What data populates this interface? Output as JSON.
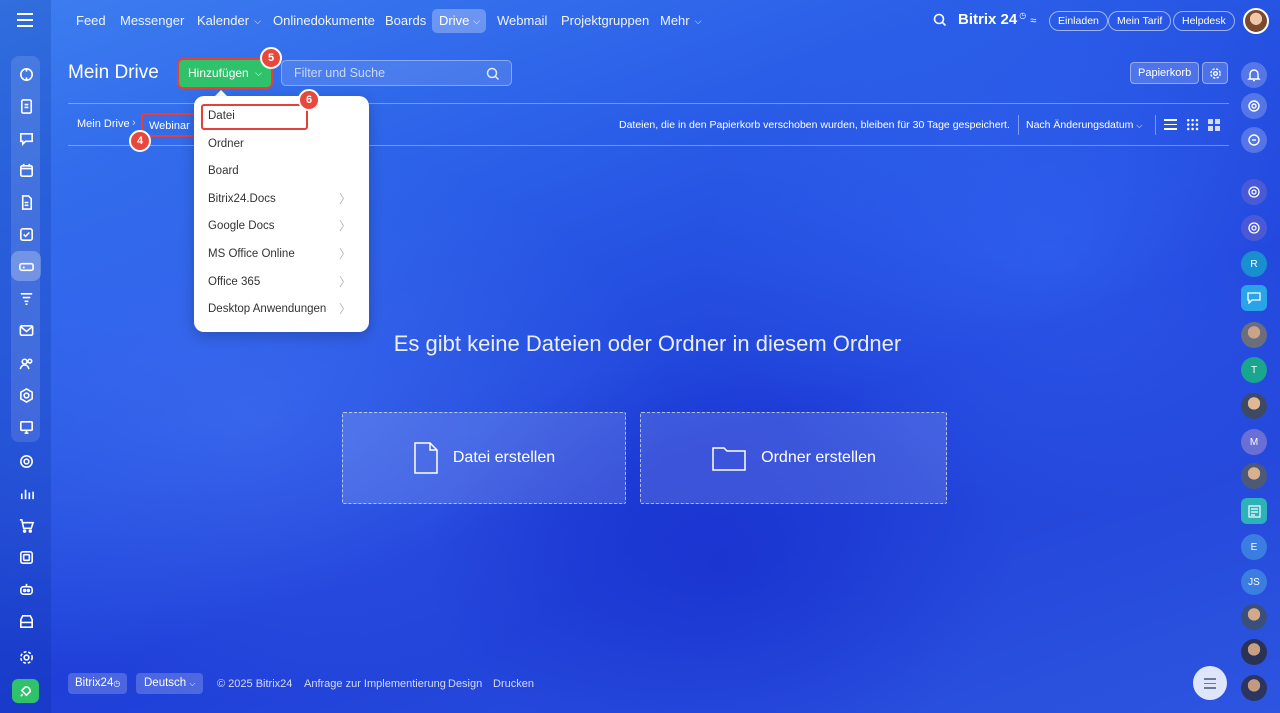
{
  "topnav": {
    "items": [
      "Feed",
      "Messenger",
      "Kalender",
      "Onlinedokumente",
      "Boards",
      "Drive",
      "Webmail",
      "Projektgruppen",
      "Mehr"
    ],
    "brand": "Bitrix 24",
    "invite": "Einladen",
    "my_plan": "Mein Tarif",
    "helpdesk": "Helpdesk"
  },
  "page": {
    "title": "Mein Drive",
    "add_button": "Hinzufügen",
    "search_placeholder": "Filter und Suche",
    "trash_button": "Papierkorb"
  },
  "breadcrumb": [
    "Mein Drive",
    "Webinar"
  ],
  "toolbar": {
    "notice": "Dateien, die in den Papierkorb verschoben wurden, bleiben für 30 Tage gespeichert.",
    "sort": "Nach Änderungsdatum"
  },
  "dropdown": {
    "items": [
      "Datei",
      "Ordner",
      "Board",
      "Bitrix24.Docs",
      "Google Docs",
      "MS Office Online",
      "Office 365",
      "Desktop Anwendungen"
    ]
  },
  "badges": [
    "4",
    "5",
    "6"
  ],
  "empty": {
    "message": "Es gibt keine Dateien oder Ordner in diesem Ordner",
    "create_file": "Datei erstellen",
    "create_folder": "Ordner erstellen"
  },
  "footer": {
    "brand": "Bitrix24",
    "language": "Deutsch",
    "copyright": "© 2025 Bitrix24",
    "implementation": "Anfrage zur Implementierung",
    "design": "Design",
    "print": "Drucken"
  },
  "right_rail": {
    "initials": [
      "R",
      "T",
      "M",
      "E",
      "JS"
    ]
  },
  "colors": {
    "accent_green": "#2fc26a",
    "highlight_red": "#e3413a"
  }
}
